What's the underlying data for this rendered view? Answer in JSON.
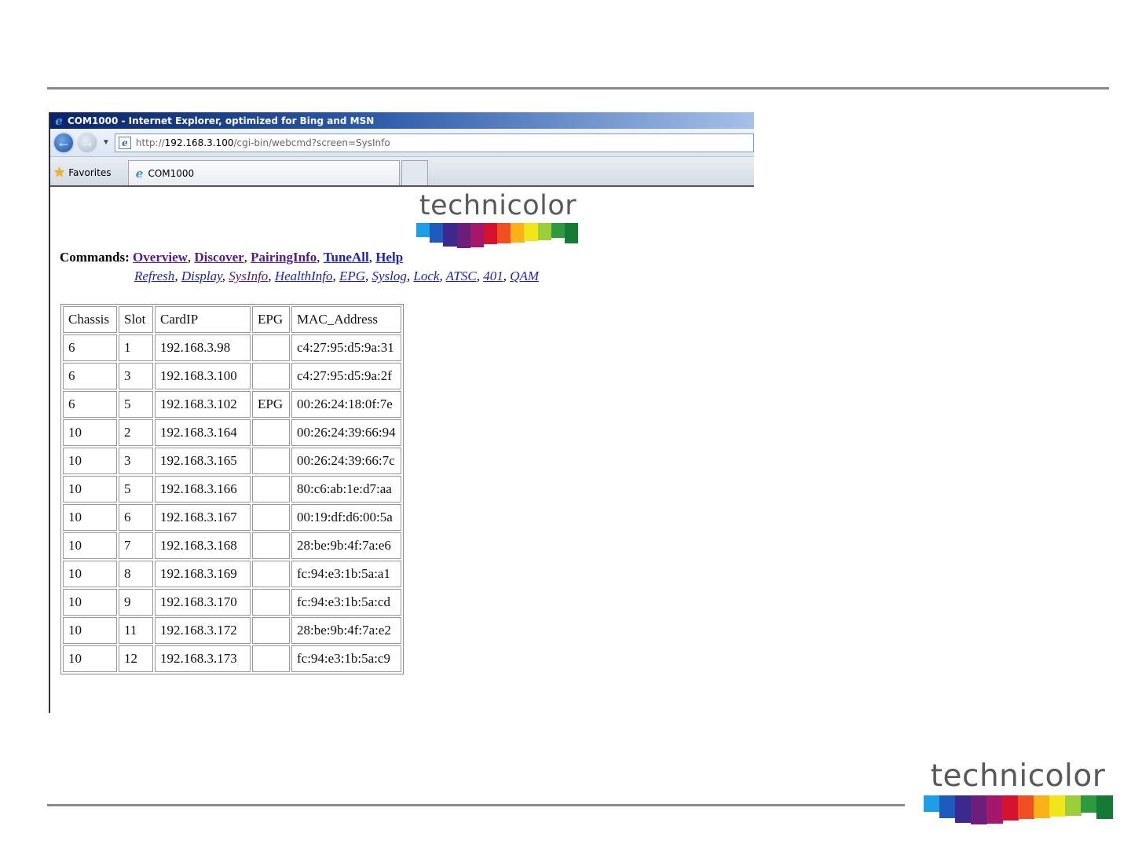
{
  "browser": {
    "title": "COM1000 - Internet Explorer, optimized for Bing and MSN",
    "url_prefix": "http://",
    "url_host": "192.168.3.100",
    "url_path": "/cgi-bin/webcmd?screen=SysInfo",
    "favorites_label": "Favorites",
    "tab_label": "COM1000"
  },
  "logo_text": "technicolor",
  "brand_colors": [
    "#1e9ee6",
    "#1f5bbf",
    "#3b2a8c",
    "#6b1f7a",
    "#a5176a",
    "#d6132e",
    "#f04e23",
    "#fbb117",
    "#f2e61b",
    "#9ccd3b",
    "#2e9a3f",
    "#147a34"
  ],
  "commands": {
    "label": "Commands:",
    "primary": [
      "Overview",
      "Discover",
      "PairingInfo",
      "TuneAll",
      "Help"
    ],
    "secondary": [
      "Refresh",
      "Display",
      "SysInfo",
      "HealthInfo",
      "EPG",
      "Syslog",
      "Lock",
      "ATSC",
      "401",
      "QAM"
    ]
  },
  "table": {
    "headers": [
      "Chassis",
      "Slot",
      "CardIP",
      "EPG",
      "MAC_Address"
    ],
    "rows": [
      [
        "6",
        "1",
        "192.168.3.98",
        "",
        "c4:27:95:d5:9a:31"
      ],
      [
        "6",
        "3",
        "192.168.3.100",
        "",
        "c4:27:95:d5:9a:2f"
      ],
      [
        "6",
        "5",
        "192.168.3.102",
        "EPG",
        "00:26:24:18:0f:7e"
      ],
      [
        "10",
        "2",
        "192.168.3.164",
        "",
        "00:26:24:39:66:94"
      ],
      [
        "10",
        "3",
        "192.168.3.165",
        "",
        "00:26:24:39:66:7c"
      ],
      [
        "10",
        "5",
        "192.168.3.166",
        "",
        "80:c6:ab:1e:d7:aa"
      ],
      [
        "10",
        "6",
        "192.168.3.167",
        "",
        "00:19:df:d6:00:5a"
      ],
      [
        "10",
        "7",
        "192.168.3.168",
        "",
        "28:be:9b:4f:7a:e6"
      ],
      [
        "10",
        "8",
        "192.168.3.169",
        "",
        "fc:94:e3:1b:5a:a1"
      ],
      [
        "10",
        "9",
        "192.168.3.170",
        "",
        "fc:94:e3:1b:5a:cd"
      ],
      [
        "10",
        "11",
        "192.168.3.172",
        "",
        "28:be:9b:4f:7a:e2"
      ],
      [
        "10",
        "12",
        "192.168.3.173",
        "",
        "fc:94:e3:1b:5a:c9"
      ]
    ]
  }
}
